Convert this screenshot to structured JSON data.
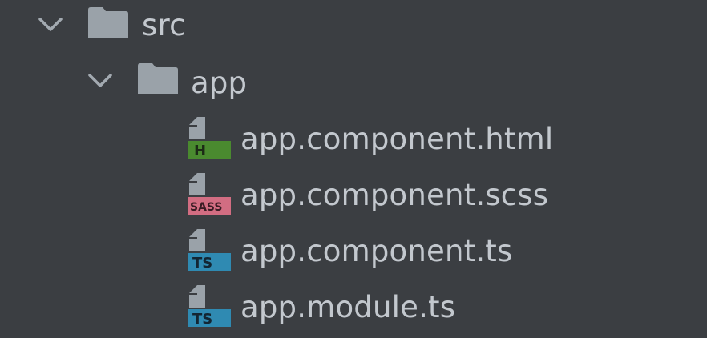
{
  "tree": {
    "root": {
      "label": "src",
      "expanded": true,
      "icon": "folder-icon"
    },
    "child": {
      "label": "app",
      "expanded": true,
      "icon": "folder-icon"
    },
    "files": [
      {
        "label": "app.component.html",
        "badge": "H",
        "badge_color": "#4a8a2f",
        "icon": "html-file-icon"
      },
      {
        "label": "app.component.scss",
        "badge": "SASS",
        "badge_color": "#d26d82",
        "icon": "sass-file-icon"
      },
      {
        "label": "app.component.ts",
        "badge": "TS",
        "badge_color": "#2f8ab2",
        "icon": "typescript-file-icon"
      },
      {
        "label": "app.module.ts",
        "badge": "TS",
        "badge_color": "#2f8ab2",
        "icon": "typescript-file-icon"
      }
    ]
  },
  "colors": {
    "background": "#3b3e42",
    "text": "#c3c8ce",
    "icon_gray": "#9aa1a8"
  }
}
